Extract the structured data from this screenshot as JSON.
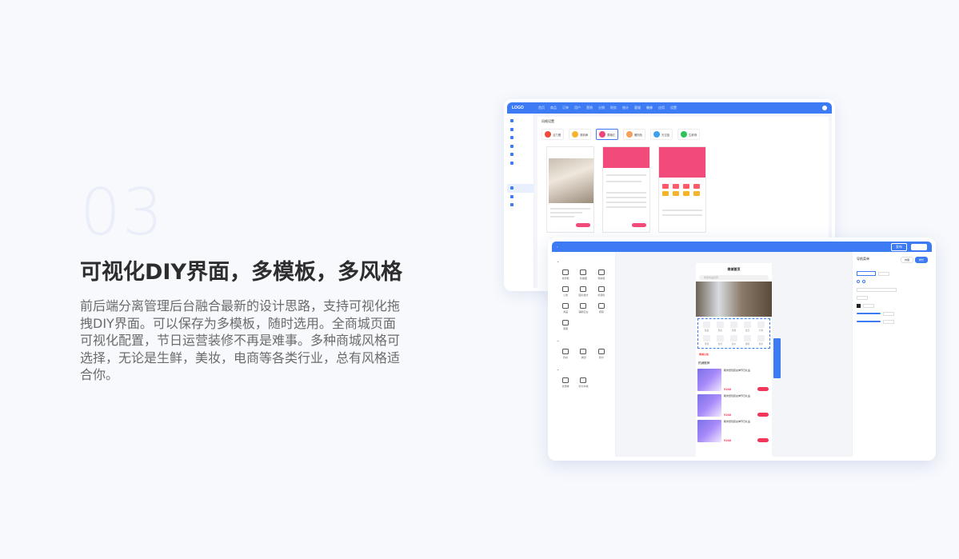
{
  "hero": {
    "number": "03",
    "title": "可视化DIY界面，多模板，多风格",
    "description": "前后端分离管理后台融合最新的设计思路，支持可视化拖拽DIY界面。可以保存为多模板，随时选用。全商城页面可视化配置，节日运营装修不再是难事。多种商城风格可选择，无论是生鲜，美妆，电商等各类行业，总有风格适合你。"
  },
  "admin_back": {
    "logo": "LOGO",
    "nav": [
      "首页",
      "商品",
      "订单",
      "用户",
      "营销",
      "分销",
      "财务",
      "统计",
      "客服",
      "装修",
      "应用",
      "设置"
    ],
    "nav_active_index": 9,
    "panel_title": "风格设置",
    "themes": [
      {
        "name": "活力橙",
        "color": "#f04a3a"
      },
      {
        "name": "清新黄",
        "color": "#f6b42a"
      },
      {
        "name": "蔷薇红",
        "color": "#f2457a"
      },
      {
        "name": "暖阳色",
        "color": "#f5a05b"
      },
      {
        "name": "天空蓝",
        "color": "#3aa3f0"
      },
      {
        "name": "生鲜绿",
        "color": "#2ec35a"
      }
    ],
    "selected_theme_index": 2
  },
  "colors": {
    "accent": "#3d7bf5",
    "brand_pink": "#f24a7a",
    "price_red": "#f2365a"
  },
  "editor": {
    "publish_label": "发布",
    "save_label": "保存",
    "component_groups": [
      {
        "items": [
          "搜索框",
          "轮播图",
          "导航组",
          "公告",
          "图片魔方",
          "标题栏",
          "商品",
          "辅助空白",
          "视频",
          "客服"
        ]
      },
      {
        "items": [
          "秒杀",
          "拼团",
          "砍价"
        ]
      },
      {
        "items": [
          "优惠券",
          "积分商城"
        ]
      }
    ],
    "phone": {
      "title": "商城首页",
      "search_placeholder": "搜索商品名称",
      "nav_items": [
        "新品",
        "热卖",
        "优惠",
        "会员",
        "分类",
        "签到",
        "积分",
        "砍价",
        "拼团",
        "秒杀"
      ],
      "notice_label": "商城公告",
      "section_title": "热销推荐",
      "products": [
        {
          "name": "糯米纸包装女神节日礼盒",
          "price": "¥168"
        },
        {
          "name": "糯米纸包装女神节日礼盒",
          "price": "¥168"
        },
        {
          "name": "糯米纸包装女神节日礼盒",
          "price": "¥168"
        }
      ]
    },
    "right_panel": {
      "title": "导航菜单",
      "toggles": [
        "内容",
        "样式"
      ],
      "toggle_active_index": 1
    }
  }
}
